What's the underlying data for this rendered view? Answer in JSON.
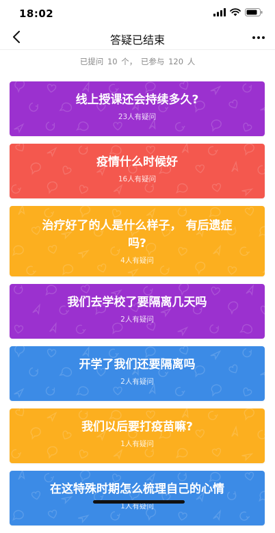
{
  "status": {
    "time": "18:02"
  },
  "nav": {
    "title": "答疑已结束"
  },
  "summary": {
    "asked_label": "已提问",
    "asked_count": "10",
    "asked_unit": "个，",
    "joined_label": "已参与",
    "joined_count": "120",
    "joined_unit": "人"
  },
  "colors": {
    "purple": "#9B31CF",
    "red": "#F4584E",
    "orange": "#FCAF1F",
    "blue": "#3C8BE6"
  },
  "cards": [
    {
      "title": "线上授课还会持续多久?",
      "count": "23人有疑问",
      "color": "purple"
    },
    {
      "title": "疫情什么时候好",
      "count": "16人有疑问",
      "color": "red"
    },
    {
      "title": "治疗好了的人是什么样子， 有后遗症吗?",
      "count": "4人有疑问",
      "color": "orange"
    },
    {
      "title": "我们去学校了要隔离几天吗",
      "count": "2人有疑问",
      "color": "purple"
    },
    {
      "title": "开学了我们还要隔离吗",
      "count": "2人有疑问",
      "color": "blue"
    },
    {
      "title": "我们以后要打疫苗嘛?",
      "count": "1人有疑问",
      "color": "orange"
    },
    {
      "title": "在这特殊时期怎么梳理自己的心情",
      "count": "1人有疑问",
      "color": "blue"
    }
  ]
}
